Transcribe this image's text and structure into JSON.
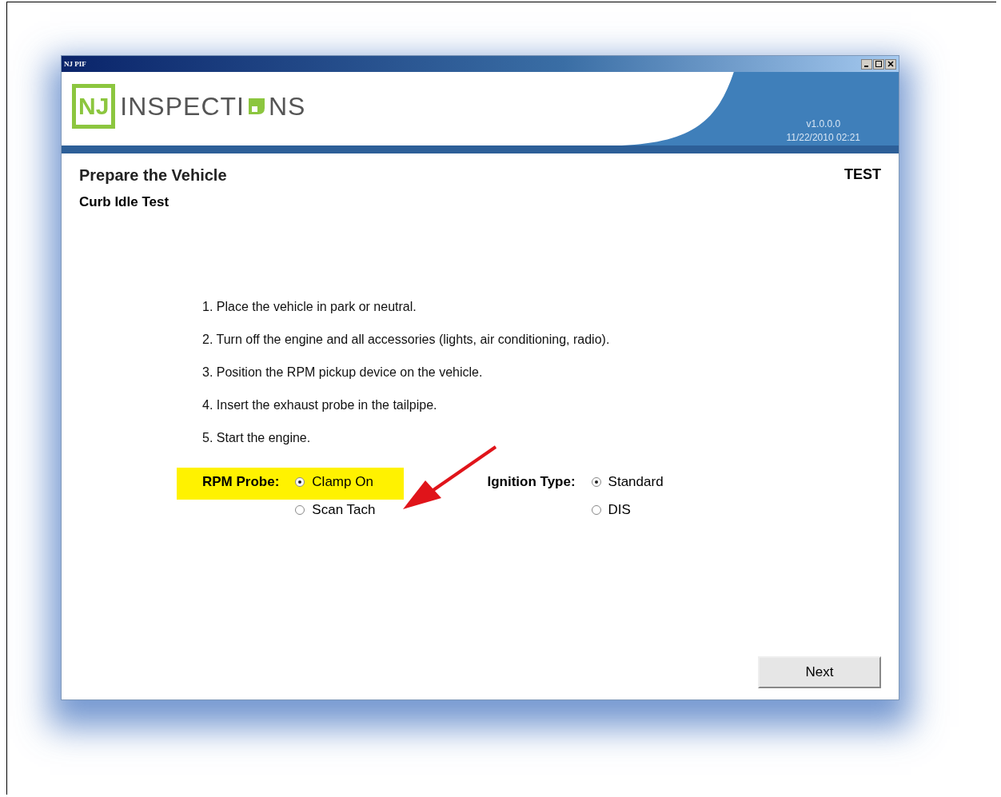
{
  "window": {
    "title": "NJ PIF"
  },
  "header": {
    "logo_box": "NJ",
    "logo_before": "INSPECTI",
    "logo_after": "NS",
    "version": "v1.0.0.0",
    "timestamp": "11/22/2010 02:21"
  },
  "page": {
    "title": "Prepare the Vehicle",
    "subtitle": "Curb Idle Test",
    "mode": "TEST"
  },
  "steps": [
    "1. Place the vehicle in park or neutral.",
    "2. Turn off the engine and all accessories (lights, air conditioning, radio).",
    "3. Position the RPM pickup device on the vehicle.",
    "4. Insert the exhaust probe in the tailpipe.",
    "5. Start the engine."
  ],
  "radio_groups": [
    {
      "label": "RPM Probe:",
      "highlighted": true,
      "options": [
        {
          "label": "Clamp On",
          "selected": true
        },
        {
          "label": "Scan Tach",
          "selected": false
        }
      ]
    },
    {
      "label": "Ignition Type:",
      "highlighted": false,
      "options": [
        {
          "label": "Standard",
          "selected": true
        },
        {
          "label": "DIS",
          "selected": false
        }
      ]
    }
  ],
  "buttons": [
    "Next"
  ]
}
